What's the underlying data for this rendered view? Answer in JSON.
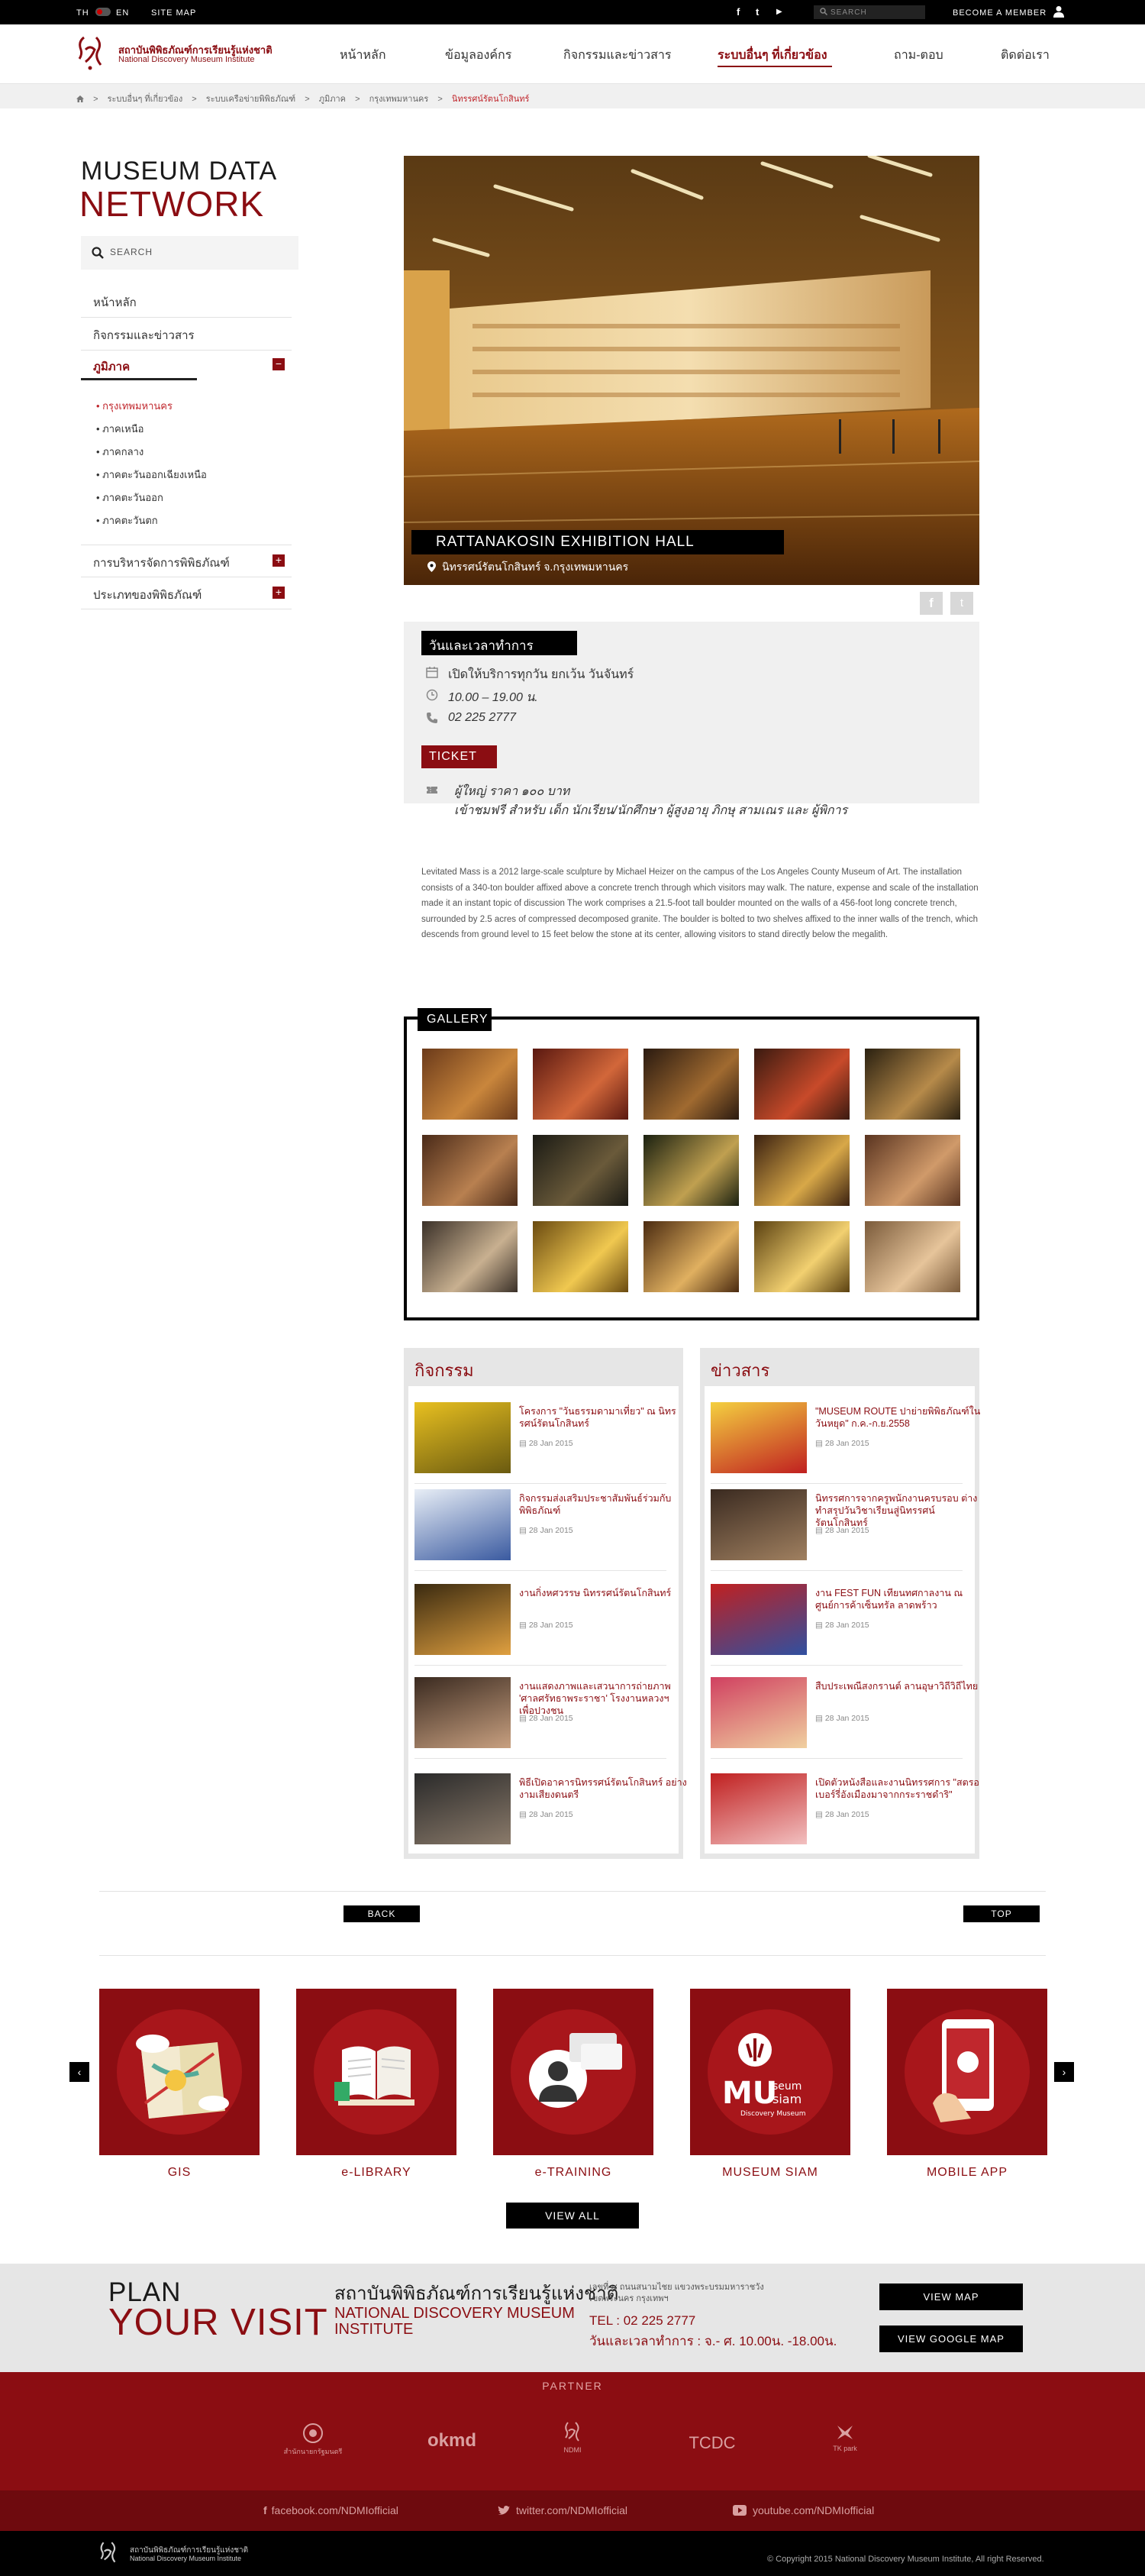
{
  "topbar": {
    "lang_th": "TH",
    "lang_en": "EN",
    "site_map": "SITE MAP",
    "social_facebook": "f",
    "social_twitter": "t",
    "social_youtube": "▶",
    "search_placeholder": "SEARCH",
    "become_member": "BECOME A MEMBER"
  },
  "header": {
    "logo_th": "สถาบันพิพิธภัณฑ์การเรียนรู้แห่งชาติ",
    "logo_en": "National Discovery Museum Institute",
    "nav": [
      "หน้าหลัก",
      "ข้อมูลองค์กร",
      "กิจกรรมและข่าวสาร",
      "ระบบอื่นๆ ที่เกี่ยวข้อง",
      "ถาม-ตอบ",
      "ติดต่อเรา"
    ]
  },
  "breadcrumb": {
    "home_icon": "home-icon",
    "items": [
      "ระบบอื่นๆ ที่เกี่ยวข้อง",
      "ระบบเครือข่ายพิพิธภัณฑ์",
      "ภูมิภาค",
      "กรุงเทพมหานคร"
    ],
    "current": "นิทรรศน์รัตนโกสินทร์"
  },
  "sidebar": {
    "title_line1": "MUSEUM DATA",
    "title_line2": "NETWORK",
    "search_label": "SEARCH",
    "links": [
      "หน้าหลัก",
      "กิจกรรมและข่าวสาร"
    ],
    "active": "ภูมิภาค",
    "sub_items": [
      "กรุงเทพมหานคร",
      "ภาคเหนือ",
      "ภาคกลาง",
      "ภาคตะวันออกเฉียงเหนือ",
      "ภาคตะวันออก",
      "ภาคตะวันตก"
    ],
    "bottom_links": [
      "การบริหารจัดการพิพิธภัณฑ์",
      "ประเภทของพิพิธภัณฑ์"
    ]
  },
  "hero": {
    "title": "RATTANAKOSIN EXHIBITION HALL",
    "subtitle": "นิทรรศน์รัตนโกสินทร์ จ.กรุงเทพมหานคร",
    "share_fb": "f",
    "share_tw": "t"
  },
  "info": {
    "heading": "วันและเวลาทำการ",
    "open_days": "เปิดให้บริการทุกวัน ยกเว้น วันจันทร์",
    "hours": "10.00 – 19.00 น.",
    "phone": "02 225 2777",
    "ticket_heading": "TICKET",
    "ticket_adult": "ผู้ใหญ่ ราคา ๑๐๐ บาท",
    "ticket_free": "เข้าชมฟรี สำหรับ เด็ก นักเรียน/นักศึกษา ผู้สูงอายุ ภิกษุ สามเณร และ ผู้พิการ"
  },
  "description": "Levitated Mass is a 2012 large-scale sculpture by Michael Heizer on the campus of the Los Angeles County Museum of Art. The installation consists of a 340-ton boulder affixed above a concrete trench through which visitors may walk. The nature, expense and scale of the installation made it an instant topic of discussion The work comprises a 21.5-foot tall boulder mounted on the walls of a 456-foot long concrete trench, surrounded by 2.5 acres of compressed decomposed granite. The boulder is bolted to two shelves affixed to the inner walls of the trench, which descends from ground level to 15 feet below the stone at its center, allowing visitors to stand directly below the megalith.",
  "gallery": {
    "heading": "GALLERY"
  },
  "activities": {
    "heading": "กิจกรรม",
    "items": [
      {
        "title": "โครงการ \"วันธรรมดามาเที่ยว\" ณ นิทรรศน์รัตนโกสินทร์",
        "date": "28 Jan 2015"
      },
      {
        "title": "กิจกรรมส่งเสริมประชาสัมพันธ์ร่วมกับพิพิธภัณฑ์",
        "date": "28 Jan 2015"
      },
      {
        "title": "งานกิ่งหศวรรษ นิทรรศน์รัตนโกสินทร์",
        "date": "28 Jan 2015"
      },
      {
        "title": "งานแสดงภาพและเสวนาการถ่ายภาพ 'ศาลศรัทธาพระราชา' โรงงานหลวงฯ เพื่อปวงชน",
        "date": "28 Jan 2015"
      },
      {
        "title": "พิธีเปิดอาคารนิทรรศน์รัตนโกสินทร์ อย่างงามเสียงดนตรี",
        "date": "28 Jan 2015"
      }
    ]
  },
  "news": {
    "heading": "ข่าวสาร",
    "items": [
      {
        "title": "\"MUSEUM ROUTE ปาย่ายพิพิธภัณฑ์ในวันหยุด\" ก.ค.-ก.ย.2558",
        "date": "28 Jan 2015"
      },
      {
        "title": "นิทรรศการจากครูพนักงานครบรอบ ต่างทำสรุปวันวิชาเรียนสู่นิทรรศน์รัตนโกสินทร์",
        "date": "28 Jan 2015"
      },
      {
        "title": "งาน FEST FUN เทียนทศกาลงาน ณ ศูนย์การค้าเซ็นทรัล ลาดพร้าว",
        "date": "28 Jan 2015"
      },
      {
        "title": "สืบประเพณีสงกรานต์ ลานอุษาวิถีวิถีไทย",
        "date": "28 Jan 2015"
      },
      {
        "title": "เปิดตัวหนังสือและงานนิทรรศการ \"สตรอเบอร์รี่อังเมืองมาจากกระราชดำริ\"",
        "date": "28 Jan 2015"
      }
    ]
  },
  "buttons": {
    "back": "BACK",
    "top": "TOP",
    "view_all": "VIEW ALL"
  },
  "services": [
    "GIS",
    "e-LIBRARY",
    "e-TRAINING",
    "MUSEUM SIAM",
    "MOBILE APP"
  ],
  "museum_siam_logo": {
    "mu": "MU",
    "seum": "seum",
    "siam": "siam",
    "discovery": "Discovery Museum"
  },
  "plan": {
    "line1": "PLAN",
    "line2": "YOUR VISIT",
    "org_th": "สถาบันพิพิธภัณฑ์การเรียนรู้แห่งชาติ",
    "org_en_1": "NATIONAL DISCOVERY MUSEUM",
    "org_en_2": "INSTITUTE",
    "address_1": "เลขที่ ๔ ถนนสนามไชย แขวงพระบรมมหาราชวัง",
    "address_2": "เขตพระนคร กรุงเทพฯ",
    "tel": "TEL : 02 225 2777",
    "hours": "วันและเวลาทำการ : จ.- ศ. 10.00น. -18.00น.",
    "view_map": "VIEW MAP",
    "view_google_map": "VIEW GOOGLE MAP"
  },
  "partner": {
    "title": "PARTNER",
    "logos": [
      "สำนักนายกรัฐมนตรี",
      "okmd",
      "NDMI",
      "TCDC",
      "TK park"
    ]
  },
  "social_footer": {
    "facebook": "facebook.com/NDMIofficial",
    "twitter": "twitter.com/NDMIofficial",
    "youtube": "youtube.com/NDMIofficial"
  },
  "footer": {
    "logo_th": "สถาบันพิพิธภัณฑ์การเรียนรู้แห่งชาติ",
    "logo_en": "National Discovery Museum Institute",
    "copyright": "© Copyright 2015 National Discovery Museum Institute, All right Reserved."
  },
  "colors": {
    "brand": "#8b0d12",
    "accent": "#c0272d",
    "dark": "#000000"
  }
}
